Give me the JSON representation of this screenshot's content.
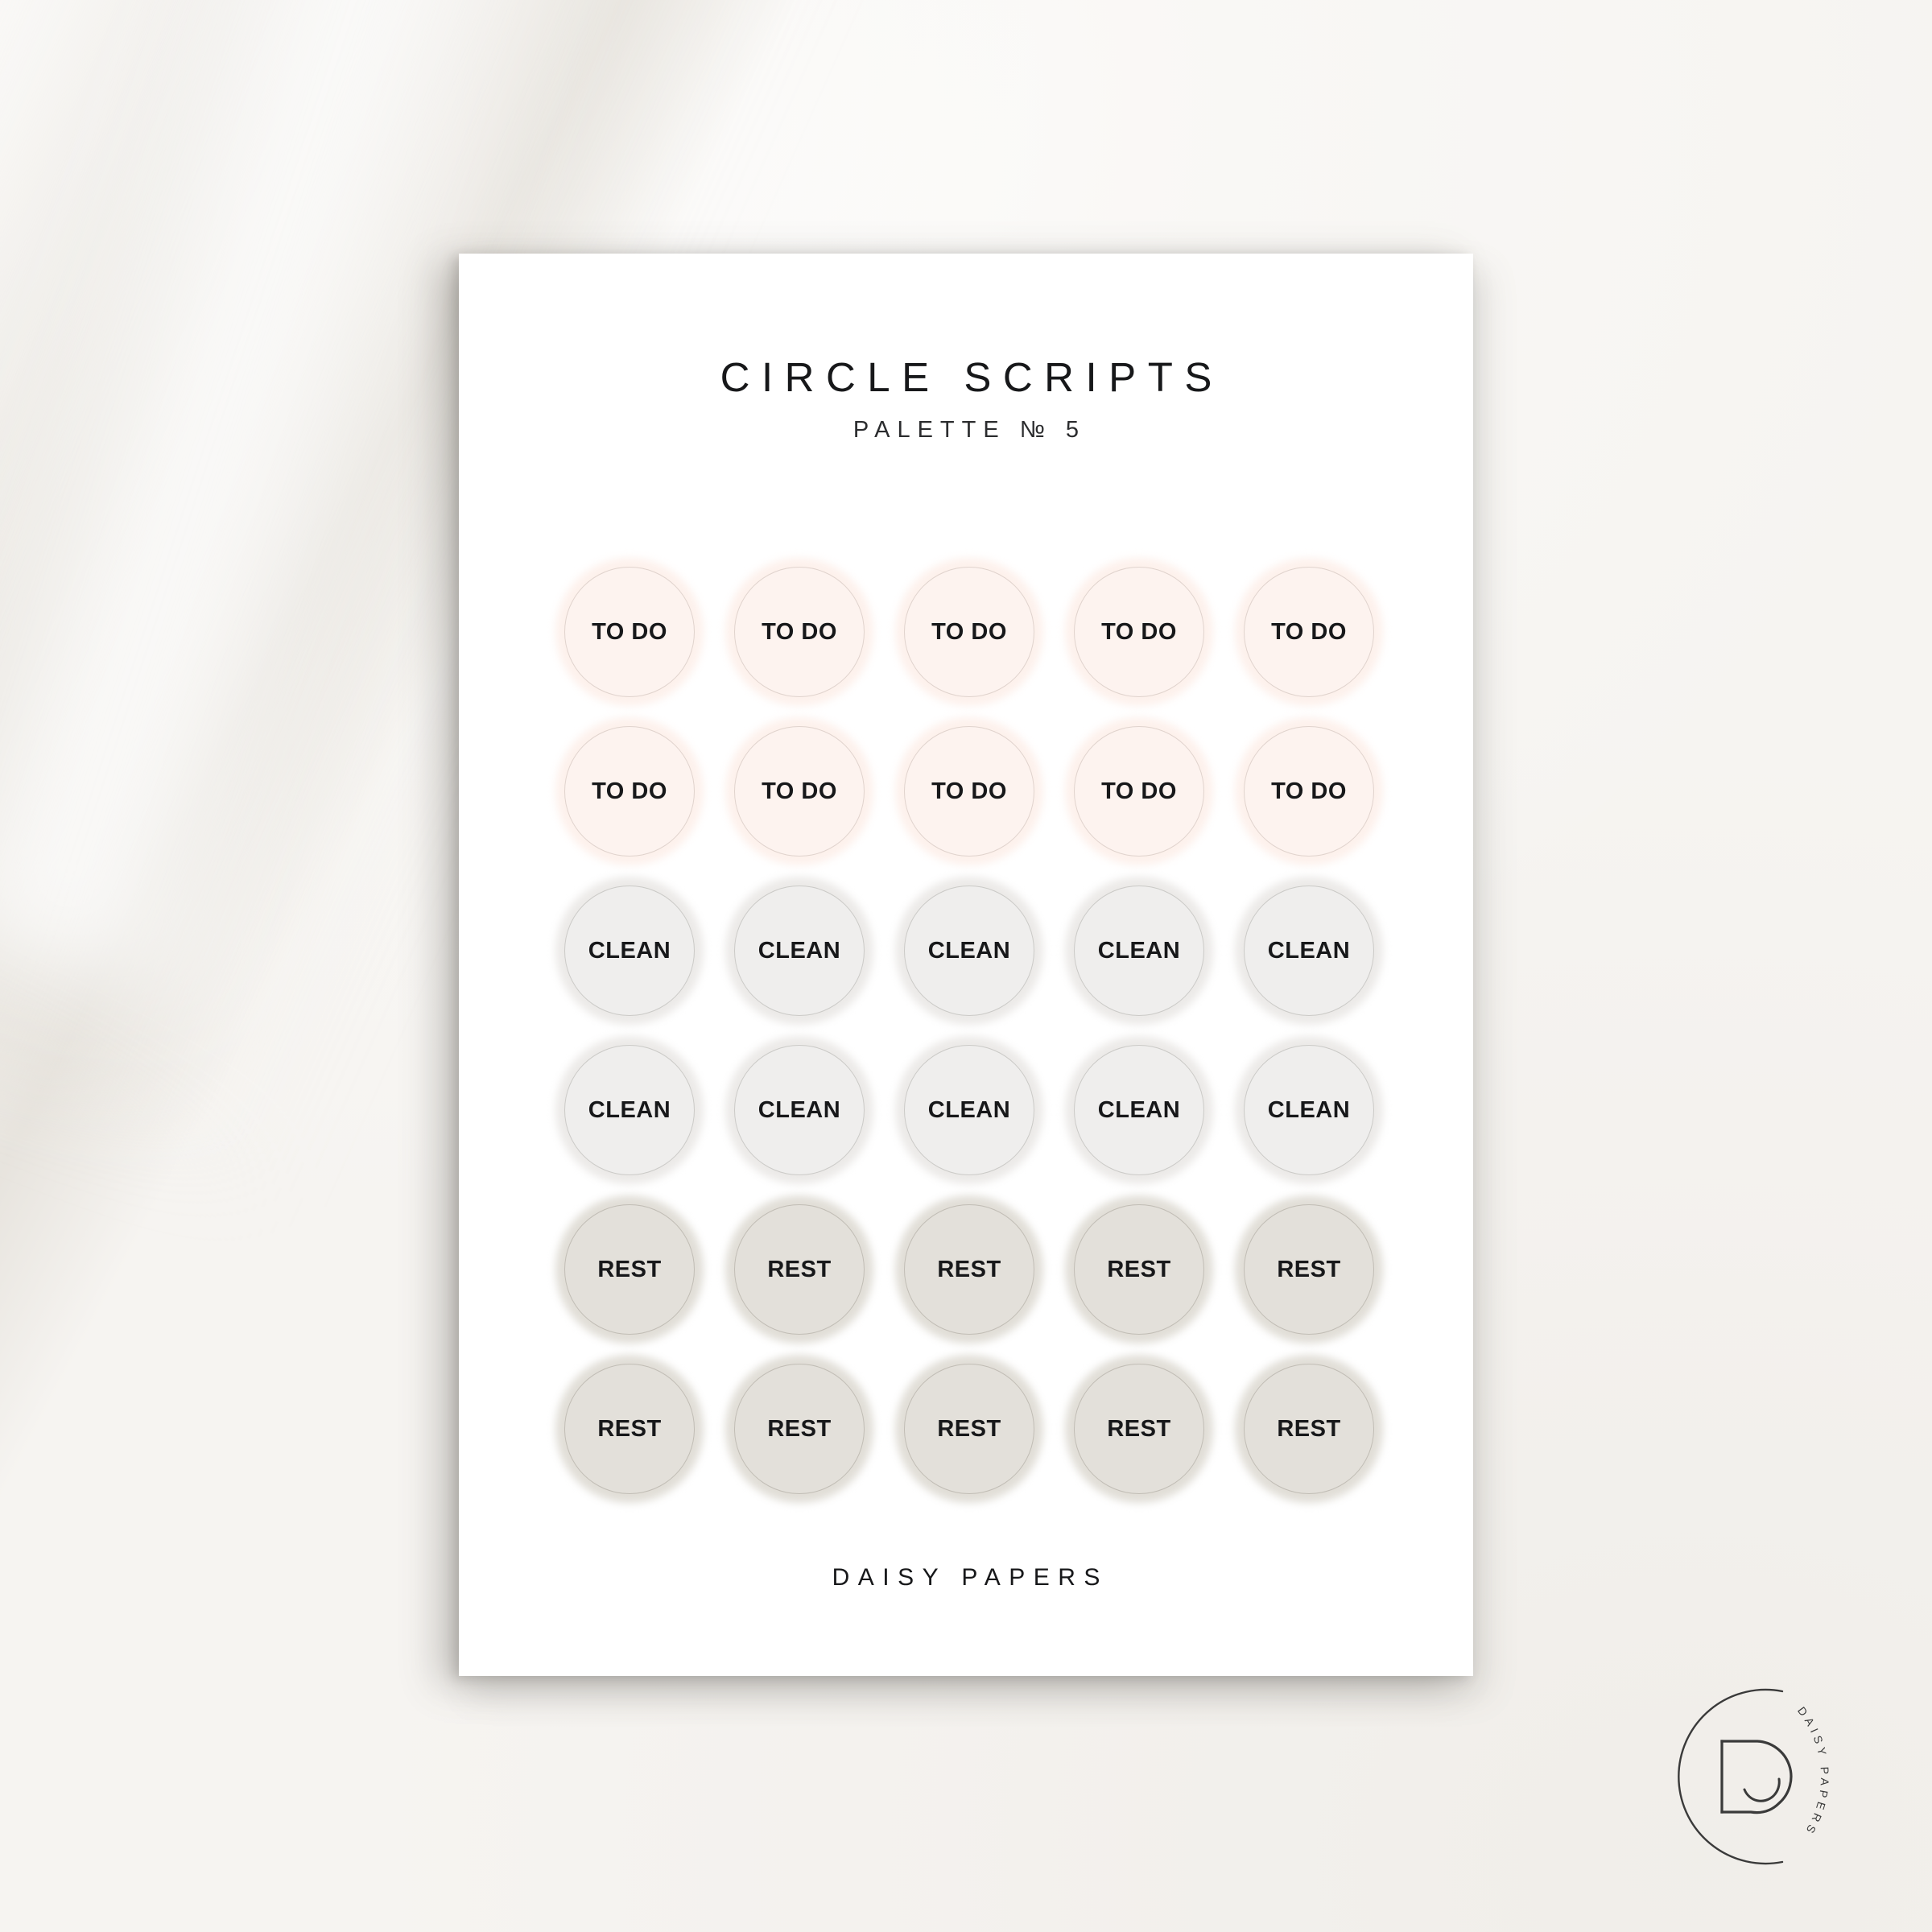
{
  "document": {
    "title": "CIRCLE SCRIPTS",
    "subtitle": "PALETTE № 5",
    "footer_brand": "DAISY PAPERS"
  },
  "palette": {
    "paper": "#ffffff",
    "backdrop": "#f6f4f1",
    "ink": "#17181a",
    "todo_fill": "#fdf3ef",
    "todo_halo": "#fdf1ec",
    "clean_fill": "#efeeed",
    "clean_halo": "#eceae8",
    "rest_fill": "#e3e0da",
    "rest_halo": "#e1ded7"
  },
  "sticker_sheet": {
    "columns": 5,
    "rows": 6,
    "rows_data": [
      {
        "style": "pal-todo",
        "label": "TO DO",
        "cells": [
          "TO DO",
          "TO DO",
          "TO DO",
          "TO DO",
          "TO DO"
        ]
      },
      {
        "style": "pal-todo",
        "label": "TO DO",
        "cells": [
          "TO DO",
          "TO DO",
          "TO DO",
          "TO DO",
          "TO DO"
        ]
      },
      {
        "style": "pal-clean",
        "label": "CLEAN",
        "cells": [
          "CLEAN",
          "CLEAN",
          "CLEAN",
          "CLEAN",
          "CLEAN"
        ]
      },
      {
        "style": "pal-clean",
        "label": "CLEAN",
        "cells": [
          "CLEAN",
          "CLEAN",
          "CLEAN",
          "CLEAN",
          "CLEAN"
        ]
      },
      {
        "style": "pal-rest",
        "label": "REST",
        "cells": [
          "REST",
          "REST",
          "REST",
          "REST",
          "REST"
        ]
      },
      {
        "style": "pal-rest",
        "label": "REST",
        "cells": [
          "REST",
          "REST",
          "REST",
          "REST",
          "REST"
        ]
      }
    ]
  },
  "watermark": {
    "icon": "daisy-papers-monogram-icon",
    "monogram_letter": "D",
    "curved_text": "DAISY PAPERS",
    "curved_text_letters": [
      "D",
      "A",
      "I",
      "S",
      "Y",
      "P",
      "A",
      "P",
      "E",
      "R",
      "S"
    ]
  }
}
